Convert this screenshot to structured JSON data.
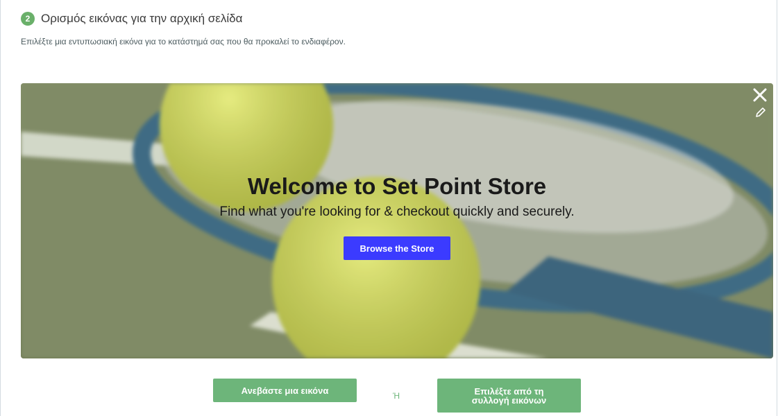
{
  "step": {
    "number": "2",
    "title": "Ορισμός εικόνας για την αρχική σελίδα",
    "description": "Επιλέξτε μια εντυπωσιακή εικόνα για το κατάστημά σας που θα προκαλεί το ενδιαφέρον."
  },
  "hero": {
    "title": "Welcome to Set Point Store",
    "subtitle": "Find what you're looking for & checkout quickly and securely.",
    "button_label": "Browse the Store",
    "close_icon": "close-icon",
    "edit_icon": "pencil-icon",
    "button_color": "#3b3bff"
  },
  "actions": {
    "upload_label": "Ανεβάστε μια εικόνα",
    "or_label": "Ή",
    "gallery_label": "Επιλέξτε από τη συλλογή εικόνων",
    "button_color": "#6db57a"
  },
  "colors": {
    "accent_green": "#6ab06a"
  }
}
